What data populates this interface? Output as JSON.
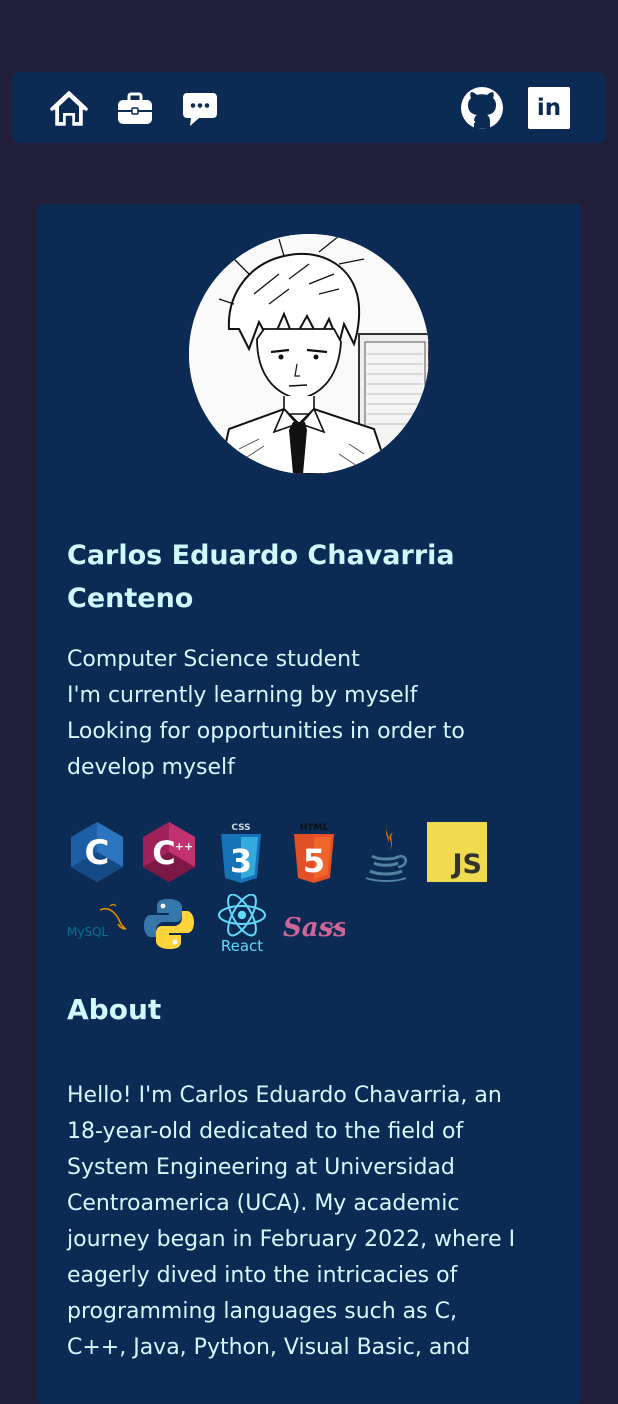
{
  "nav": {
    "left_icons": [
      "home-icon",
      "briefcase-icon",
      "chat-icon"
    ],
    "right_icons": [
      "github-icon",
      "linkedin-icon"
    ],
    "linkedin_text": "in"
  },
  "profile": {
    "name_line1": "Carlos Eduardo Chavarria",
    "name_line2": "Centeno",
    "bio": [
      "Computer Science student",
      "I'm currently learning by myself",
      "Looking for opportunities in order to",
      "develop myself"
    ]
  },
  "tech_icons": {
    "c": "C",
    "cpp": "C",
    "cpp_sup": "++",
    "css_label": "CSS",
    "css_num": "3",
    "html_label": "HTML",
    "html_num": "5",
    "js": "JS",
    "mysql": "MySQL",
    "react": "React",
    "sass": "Sass"
  },
  "about": {
    "heading": "About",
    "lines": [
      "Hello! I'm Carlos Eduardo Chavarria, an",
      "18-year-old dedicated to the field of",
      "System Engineering at Universidad",
      "Centroamerica (UCA). My academic",
      "journey began in February 2022, where I",
      "eagerly dived into the intricacies of",
      "programming languages such as C,",
      "C++, Java, Python, Visual Basic, and"
    ]
  },
  "colors": {
    "background": "#211f3a",
    "card": "#0b2a54",
    "heading": "#cff8ff",
    "text": "#d8f7ff"
  }
}
